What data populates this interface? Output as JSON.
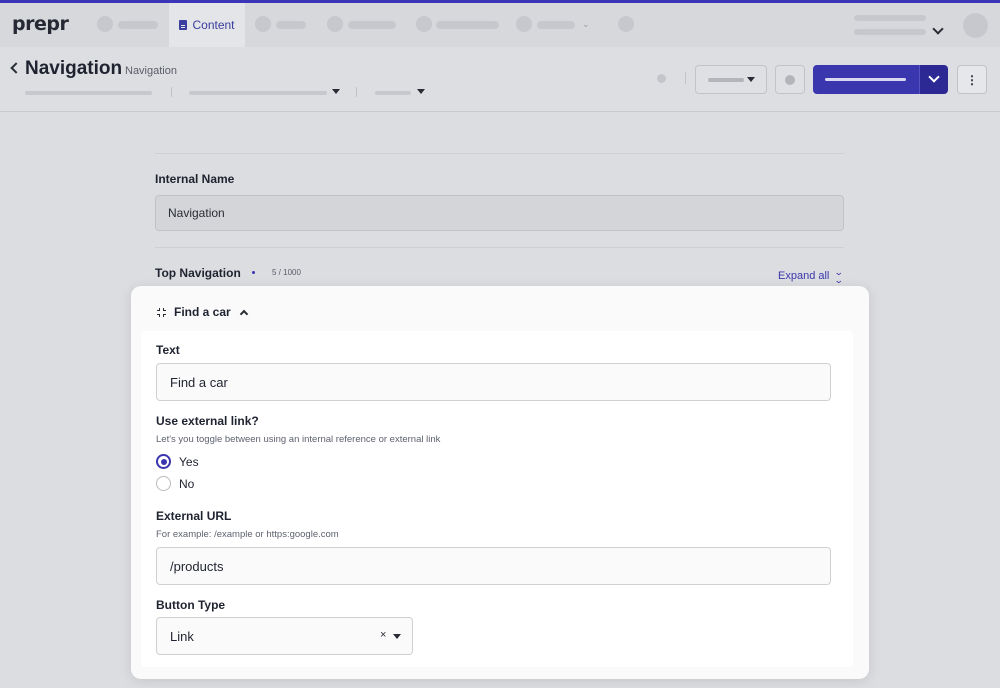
{
  "app": {
    "logo": "prepr"
  },
  "topnav": {
    "active_tab": "Content",
    "icons": {
      "content": "document-icon"
    }
  },
  "header": {
    "title": "Navigation",
    "subtitle": "Navigation"
  },
  "form": {
    "internal_name": {
      "label": "Internal Name",
      "value": "Navigation"
    },
    "top_navigation": {
      "label": "Top Navigation",
      "counter": "5 / 1000",
      "expand_all": "Expand all"
    }
  },
  "card": {
    "title": "Find a car",
    "text_field": {
      "label": "Text",
      "value": "Find a car"
    },
    "external_link": {
      "label": "Use external link?",
      "help": "Let's you toggle between using an internal reference or external link",
      "options": [
        {
          "label": "Yes",
          "checked": true
        },
        {
          "label": "No",
          "checked": false
        }
      ]
    },
    "external_url": {
      "label": "External URL",
      "help": "For example: /example or https:google.com",
      "value": "/products"
    },
    "button_type": {
      "label": "Button Type",
      "value": "Link",
      "clear_glyph": "×"
    }
  },
  "colors": {
    "accent": "#3a36ad",
    "topline": "#3b35b8"
  }
}
